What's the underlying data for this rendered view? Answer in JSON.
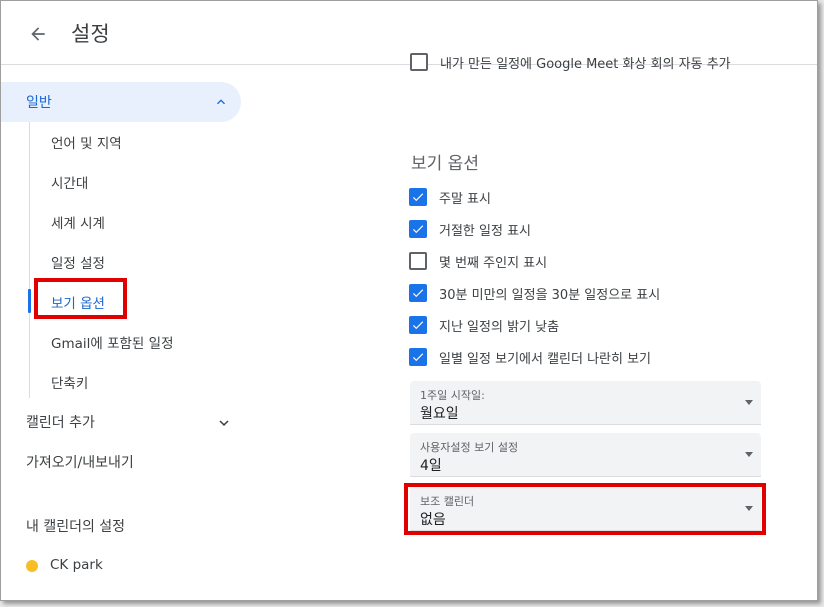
{
  "header": {
    "title": "설정"
  },
  "sidebar": {
    "general": "일반",
    "sub_items": [
      {
        "label": "언어 및 지역"
      },
      {
        "label": "시간대"
      },
      {
        "label": "세계 시계"
      },
      {
        "label": "일정 설정"
      },
      {
        "label": "보기 옵션"
      },
      {
        "label": "Gmail에 포함된 일정"
      },
      {
        "label": "단축키"
      }
    ],
    "add_calendar": "캘린더 추가",
    "import_export": "가져오기/내보내기",
    "my_calendars_heading": "내 캘린더의 설정",
    "calendar_name": "CK park",
    "calendar_color": "#f6bf26"
  },
  "main": {
    "partial_option": "내가 만든 일정에 Google Meet 화상 회의 자동 추가",
    "section_title": "보기 옵션",
    "options": [
      {
        "label": "주말 표시",
        "checked": true
      },
      {
        "label": "거절한 일정 표시",
        "checked": true
      },
      {
        "label": "몇 번째 주인지 표시",
        "checked": false
      },
      {
        "label": "30분 미만의 일정을 30분 일정으로 표시",
        "checked": true
      },
      {
        "label": "지난 일정의 밝기 낮춤",
        "checked": true
      },
      {
        "label": "일별 일정 보기에서 캘린더 나란히 보기",
        "checked": true
      }
    ],
    "selects": [
      {
        "label": "1주일 시작일:",
        "value": "월요일"
      },
      {
        "label": "사용자설정 보기 설정",
        "value": "4일"
      },
      {
        "label": "보조 캘린더",
        "value": "없음"
      }
    ]
  },
  "colors": {
    "accent": "#1a73e8",
    "highlight": "#e00000",
    "active_bg": "#e8f0fe"
  }
}
